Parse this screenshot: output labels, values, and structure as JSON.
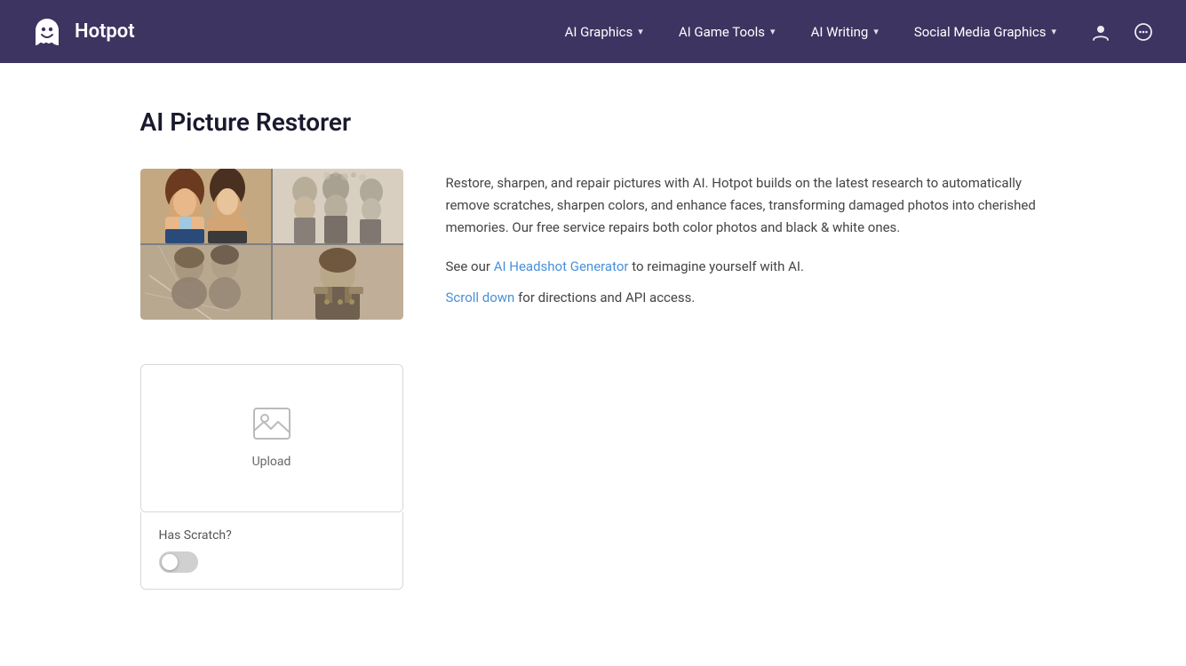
{
  "brand": {
    "logo_alt": "Hotpot logo",
    "title": "Hotpot"
  },
  "navbar": {
    "items": [
      {
        "label": "AI Graphics",
        "id": "ai-graphics"
      },
      {
        "label": "AI Game Tools",
        "id": "ai-game-tools"
      },
      {
        "label": "AI Writing",
        "id": "ai-writing"
      },
      {
        "label": "Social Media Graphics",
        "id": "social-media-graphics"
      }
    ]
  },
  "page": {
    "title": "AI Picture Restorer"
  },
  "intro": {
    "description": "Restore, sharpen, and repair pictures with AI. Hotpot builds on the latest research to automatically remove scratches, sharpen colors, and enhance faces, transforming damaged photos into cherished memories. Our free service repairs both color photos and black & white ones.",
    "link_prefix": "See our",
    "link_text": "AI Headshot Generator",
    "link_suffix": "to reimagine yourself with AI.",
    "scroll_prefix": "Scroll down",
    "scroll_suffix": "for directions and API access."
  },
  "upload": {
    "label": "Upload",
    "icon": "🖼"
  },
  "scratch": {
    "label": "Has Scratch?"
  },
  "icons": {
    "user": "👤",
    "chat": "💬",
    "chevron": "▾"
  }
}
